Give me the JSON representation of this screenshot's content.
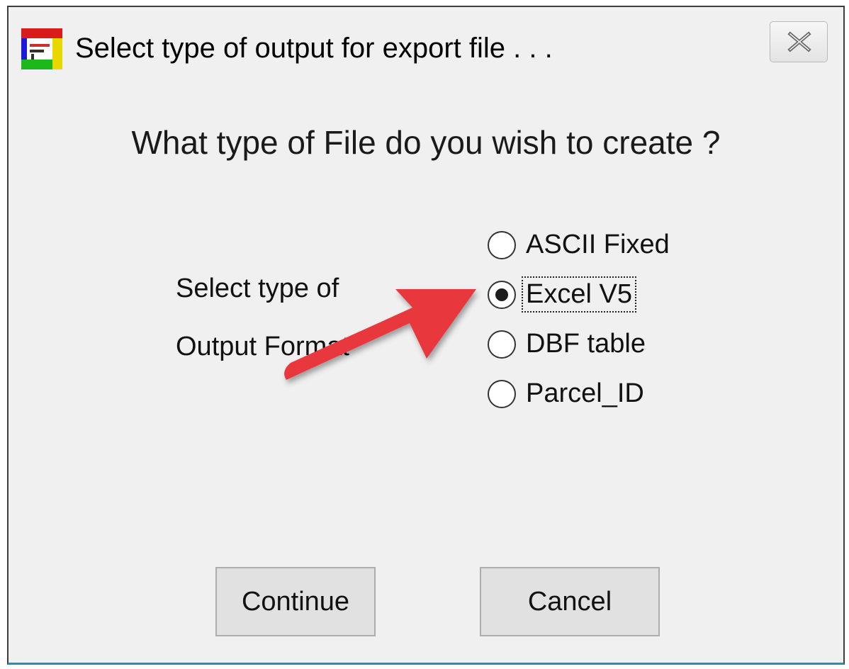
{
  "window": {
    "title": "Select type of output for export file . . .",
    "icons": {
      "app": "app-icon",
      "close": "close-icon"
    }
  },
  "dialog": {
    "question": "What type of File do you wish to create ?",
    "output_label_line1": "Select type of",
    "output_label_line2": "Output Format"
  },
  "options": [
    {
      "label": "ASCII Fixed",
      "selected": false
    },
    {
      "label": "Excel V5",
      "selected": true
    },
    {
      "label": "DBF table",
      "selected": false
    },
    {
      "label": "Parcel_ID",
      "selected": false
    }
  ],
  "buttons": {
    "continue": "Continue",
    "cancel": "Cancel"
  },
  "annotation": {
    "type": "arrow",
    "color": "#e8383d",
    "points_to": "Excel V5"
  }
}
